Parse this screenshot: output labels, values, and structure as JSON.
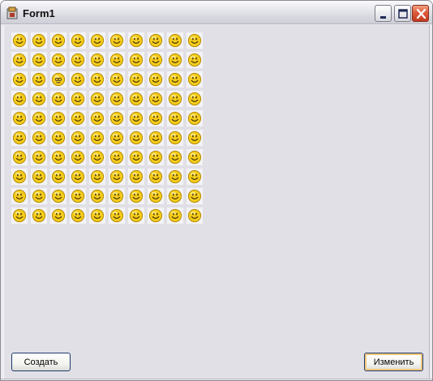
{
  "window": {
    "title": "Form1",
    "app_icon": "app-icon"
  },
  "grid": {
    "rows": 10,
    "cols": 10,
    "cell_icon": "smiley-face-icon",
    "odd_cell": {
      "row": 3,
      "col": 3,
      "icon": "sleepy-face-icon"
    }
  },
  "buttons": {
    "create_label": "Создать",
    "change_label": "Изменить"
  },
  "colors": {
    "smiley_fill": "#f5cc1c",
    "smiley_outline": "#b38a00",
    "background": "#e1e0e6"
  }
}
